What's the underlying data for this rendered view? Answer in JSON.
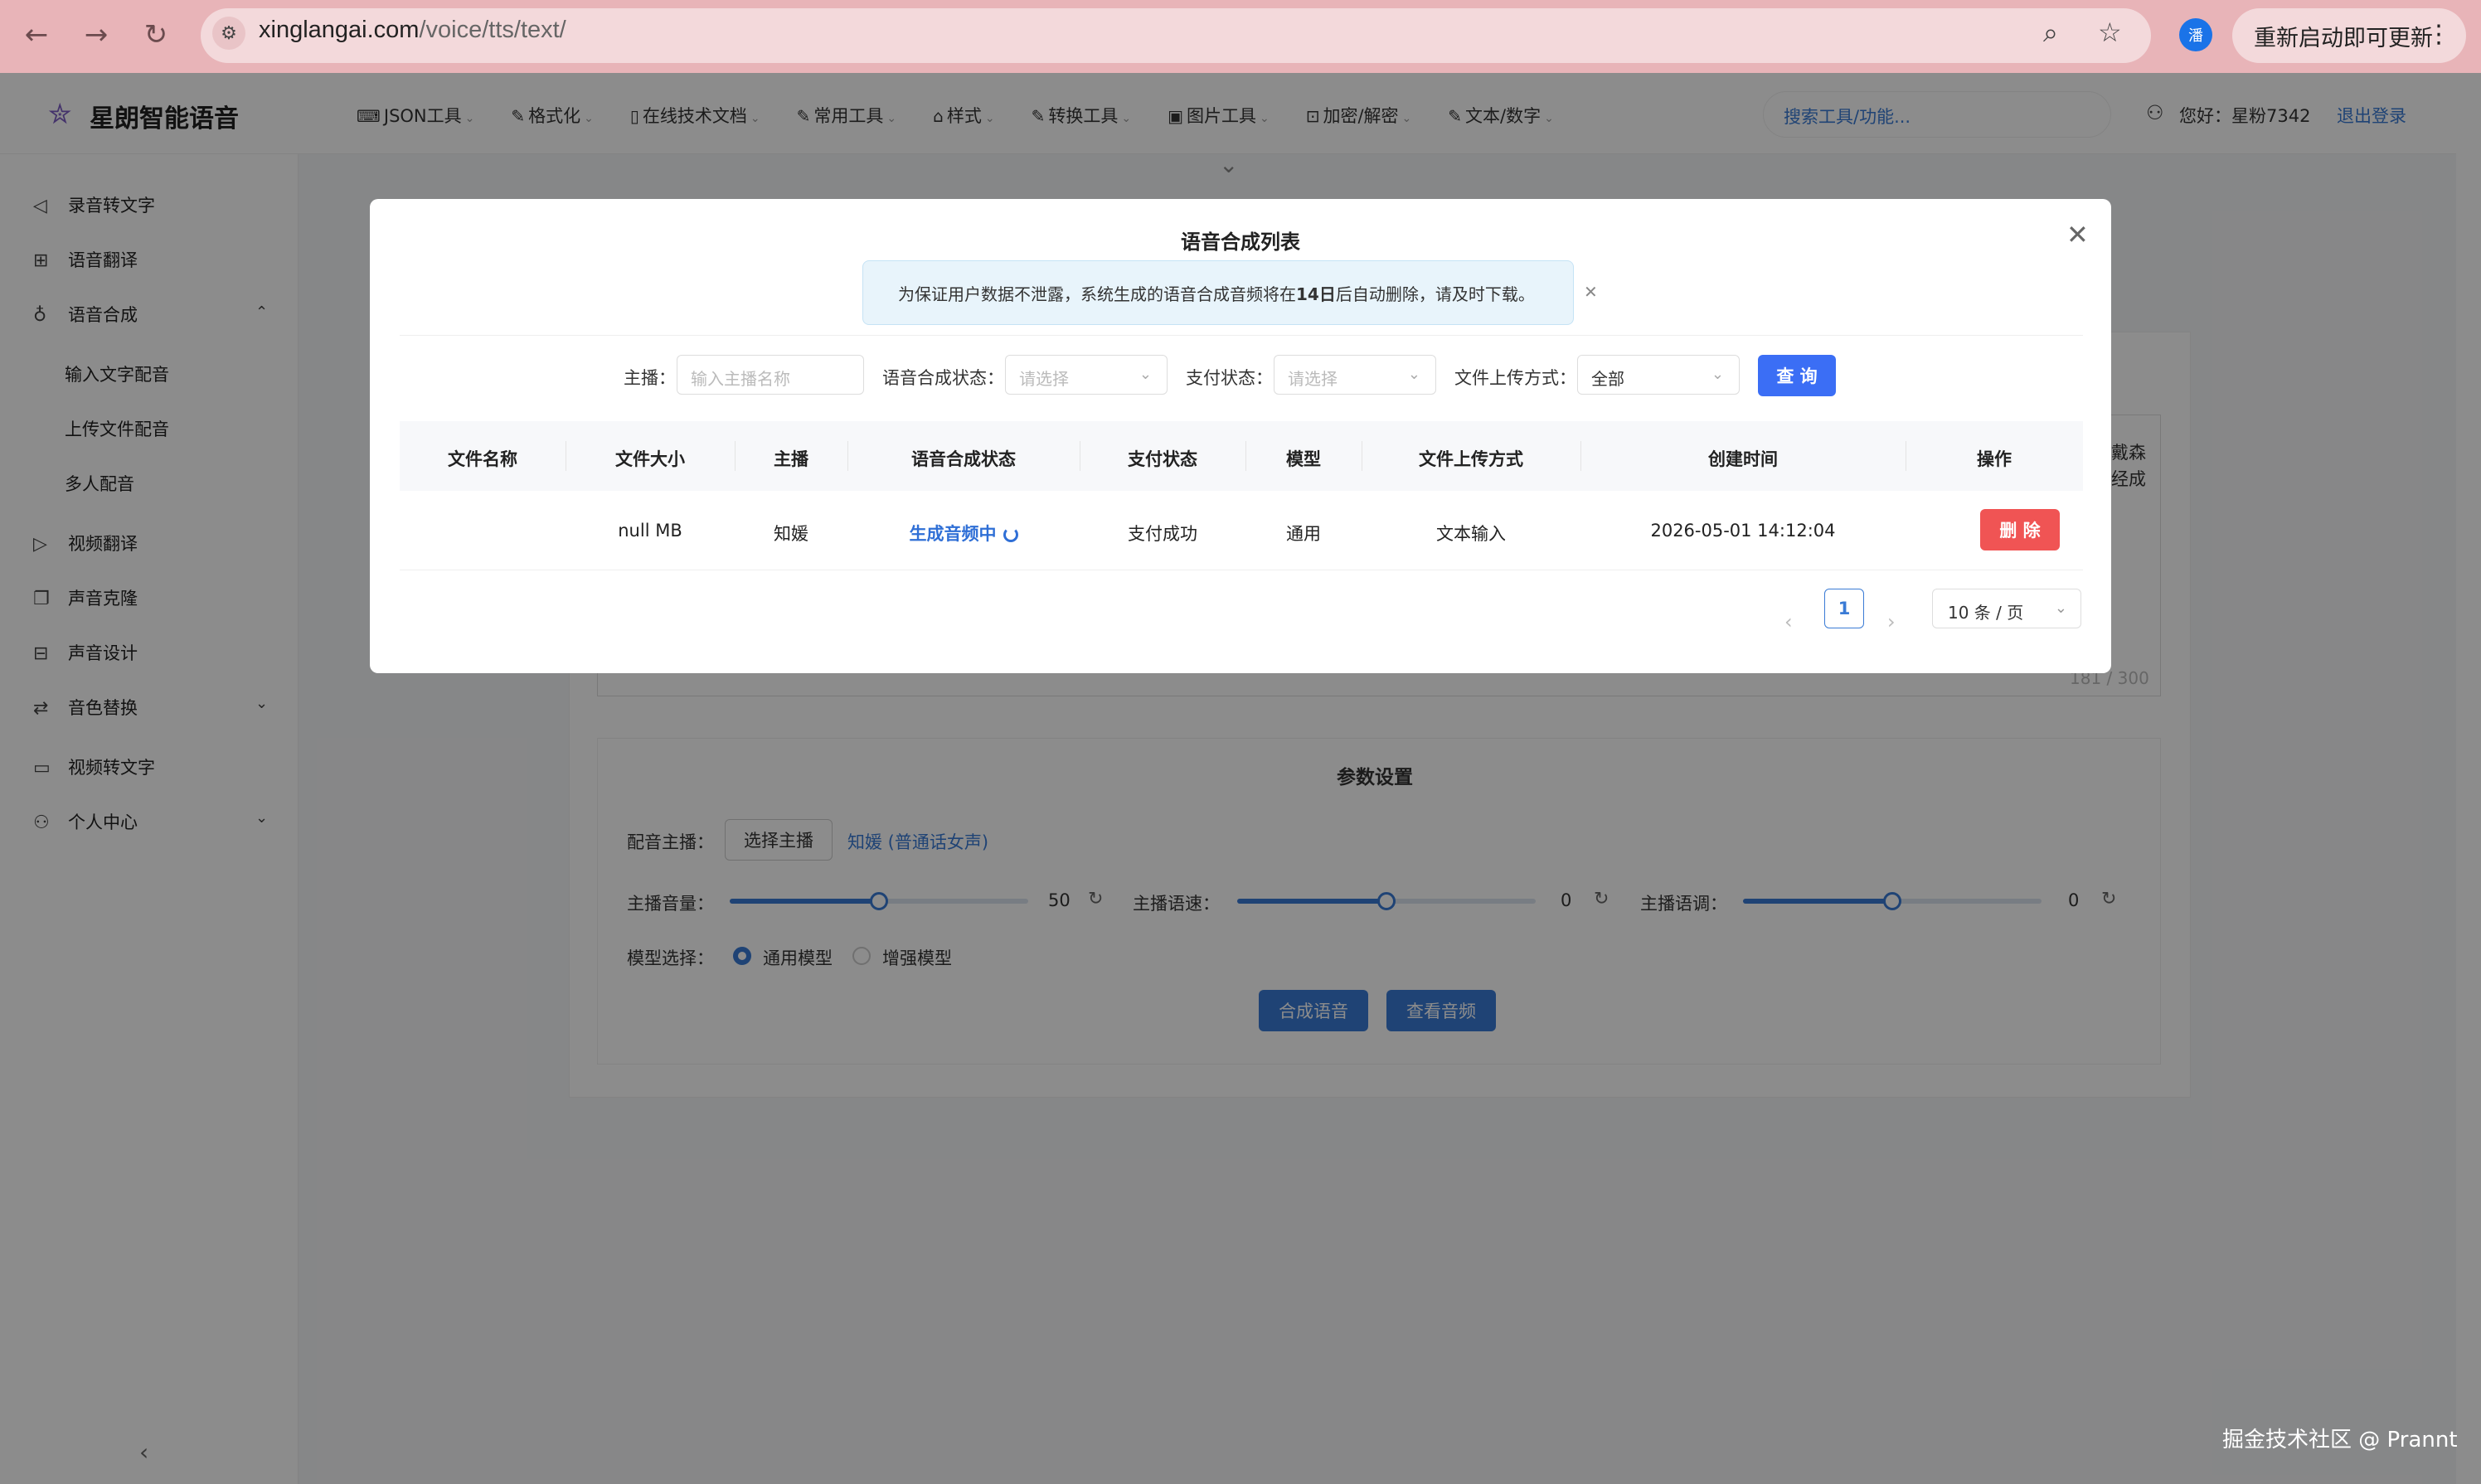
{
  "browser": {
    "url_host": "xinglangai.com",
    "url_path": "/voice/tts/text/",
    "profile_initial": "潘",
    "restart_label": "重新启动即可更新"
  },
  "header": {
    "brand": "星朗智能语音",
    "menu": [
      {
        "label": "JSON工具",
        "icon": "terminal-icon"
      },
      {
        "label": "格式化",
        "icon": "edit-icon"
      },
      {
        "label": "在线技术文档",
        "icon": "document-icon"
      },
      {
        "label": "常用工具",
        "icon": "edit-icon"
      },
      {
        "label": "样式",
        "icon": "paint-icon"
      },
      {
        "label": "转换工具",
        "icon": "edit-icon"
      },
      {
        "label": "图片工具",
        "icon": "image-icon"
      },
      {
        "label": "加密/解密",
        "icon": "lock-icon"
      },
      {
        "label": "文本/数字",
        "icon": "edit-icon"
      }
    ],
    "search_placeholder": "搜索工具/功能...",
    "greeting": "您好：星粉7342",
    "logout": "退出登录"
  },
  "sidebar": {
    "items": [
      {
        "label": "录音转文字",
        "icon": "speaker-icon"
      },
      {
        "label": "语音翻译",
        "icon": "translate-icon"
      },
      {
        "label": "语音合成",
        "icon": "microphone-icon"
      },
      {
        "label": "视频翻译",
        "icon": "play-icon"
      },
      {
        "label": "声音克隆",
        "icon": "copy-icon"
      },
      {
        "label": "声音设计",
        "icon": "sliders-icon"
      },
      {
        "label": "音色替换",
        "icon": "swap-icon"
      },
      {
        "label": "视频转文字",
        "icon": "video-icon"
      },
      {
        "label": "个人中心",
        "icon": "user-icon"
      }
    ],
    "sub_items": [
      "输入文字配音",
      "上传文件配音",
      "多人配音"
    ]
  },
  "background": {
    "side_text_1": "戴森",
    "side_text_2": "经成",
    "char_count": "181 / 300",
    "params_title": "参数设置",
    "voice_label": "配音主播：",
    "choose_voice": "选择主播",
    "voice_name": "知媛 (普通话女声)",
    "volume_label": "主播音量：",
    "volume_value": "50",
    "volume_level": 0.5,
    "speed_label": "主播语速：",
    "speed_value": "0",
    "speed_level": 0.5,
    "pitch_label": "主播语调：",
    "pitch_value": "0",
    "pitch_level": 0.5,
    "model_label": "模型选择：",
    "model_options": [
      "通用模型",
      "增强模型"
    ],
    "synth_button": "合成语音",
    "view_button": "查看音频",
    "watermark": "掘金技术社区 @ Prannt"
  },
  "modal": {
    "title": "语音合成列表",
    "notice_prefix": "为保证用户数据不泄露，系统生成的语音合成音频将在",
    "notice_bold": "14日",
    "notice_suffix": "后自动删除，请及时下载。",
    "filters": {
      "anchor_label": "主播：",
      "anchor_placeholder": "输入主播名称",
      "synth_status_label": "语音合成状态：",
      "synth_status_placeholder": "请选择",
      "pay_status_label": "支付状态：",
      "pay_status_placeholder": "请选择",
      "upload_method_label": "文件上传方式：",
      "upload_method_value": "全部",
      "query_button": "查 询"
    },
    "columns": [
      "文件名称",
      "文件大小",
      "主播",
      "语音合成状态",
      "支付状态",
      "模型",
      "文件上传方式",
      "创建时间",
      "操作"
    ],
    "rows": [
      {
        "file_name": "",
        "file_size": "null MB",
        "anchor": "知媛",
        "synth_status": "生成音频中",
        "pay_status": "支付成功",
        "model": "通用",
        "upload_method": "文本输入",
        "created_at": "2026-05-01 14:12:04",
        "action": "删 除"
      }
    ],
    "pagination": {
      "current": "1",
      "page_size": "10 条 / 页"
    }
  }
}
